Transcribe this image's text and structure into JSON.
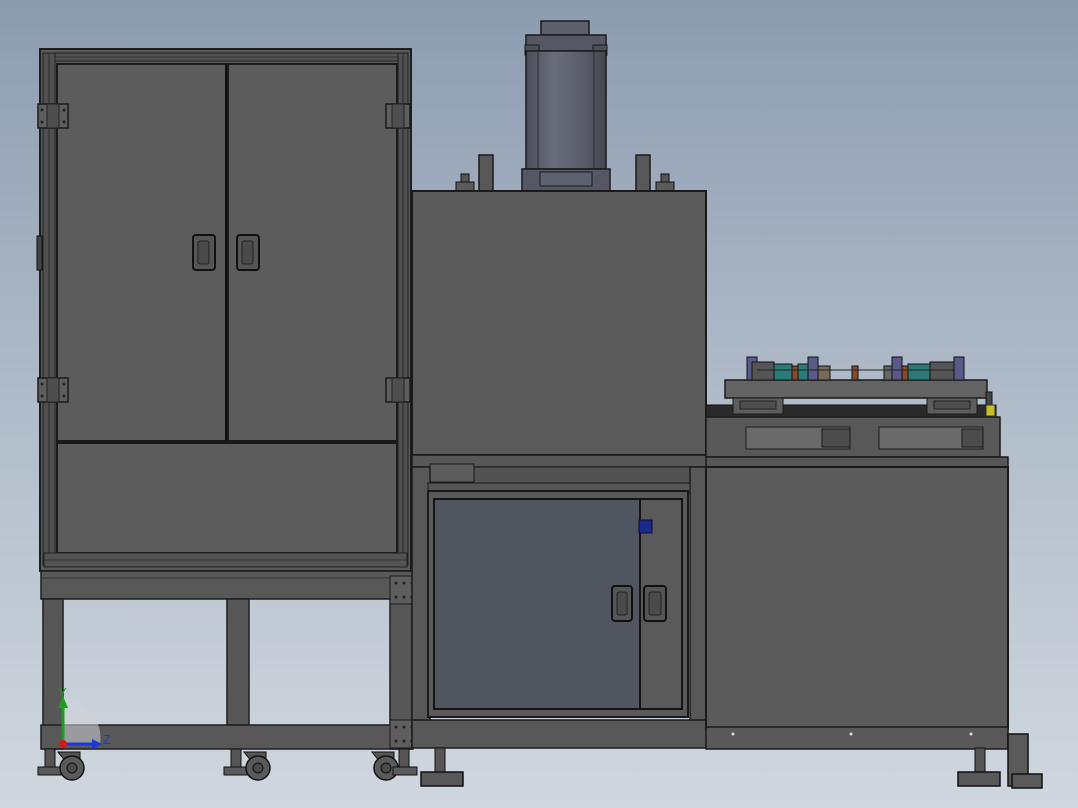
{
  "colors": {
    "body": "#5a5a5a",
    "body_dark": "#4a4a4a",
    "edge": "#1e1e1e",
    "frame": "#555555",
    "door_window": "#50555f",
    "cylinder": "#5d6170",
    "indicator": "#1a2a8a",
    "axis_y": "#1aa01a",
    "axis_z": "#1a3ad0",
    "axis_x": "#d01a1a",
    "teal": "#2a7a78",
    "copper": "#8a4a2a",
    "violet": "#5a5a8a",
    "yellow": "#c8c020"
  },
  "axes": {
    "y_label": "Y",
    "z_label": "Z"
  },
  "icons": {
    "triad": "coordinate-triad-icon",
    "handle": "door-handle-icon",
    "hinge": "hinge-icon",
    "caster": "caster-wheel-icon"
  }
}
